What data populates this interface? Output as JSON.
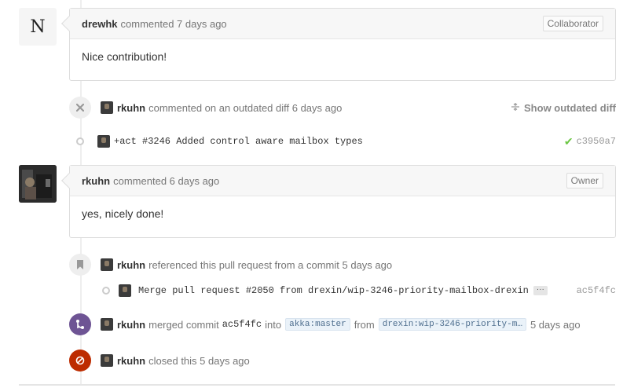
{
  "comments": [
    {
      "avatar_letter": "N",
      "author": "drewhk",
      "action": "commented 7 days ago",
      "role": "Collaborator",
      "body": "Nice contribution!"
    },
    {
      "author": "rkuhn",
      "action": "commented 6 days ago",
      "role": "Owner",
      "body": "yes, nicely done!"
    }
  ],
  "outdated_diff": {
    "icon": "x-icon",
    "author": "rkuhn",
    "action": "commented on an outdated diff 6 days ago",
    "toggle_icon": "fold-icon",
    "toggle_label": "Show outdated diff"
  },
  "commit_1": {
    "message": "+act #3246 Added control aware mailbox types",
    "status_icon": "check-icon",
    "sha": "c3950a7"
  },
  "reference": {
    "icon": "bookmark-icon",
    "author": "rkuhn",
    "action": "referenced this pull request from a commit 5 days ago"
  },
  "commit_2": {
    "message": "Merge pull request #2050 from drexin/wip-3246-priority-mailbox-drexin",
    "ellipsis": "···",
    "sha": "ac5f4fc"
  },
  "merge": {
    "icon": "merge-icon",
    "author": "rkuhn",
    "text_1": "merged commit",
    "sha": "ac5f4fc",
    "text_2": "into",
    "base_branch": "akka:master",
    "text_3": "from",
    "head_branch": "drexin:wip-3246-priority-m…",
    "time": "5 days ago"
  },
  "closed": {
    "icon": "closed-icon",
    "author": "rkuhn",
    "action": "closed this 5 days ago"
  },
  "colors": {
    "merge_badge": "#6e5494",
    "closed_badge": "#bd2c00",
    "check": "#6cc644"
  }
}
